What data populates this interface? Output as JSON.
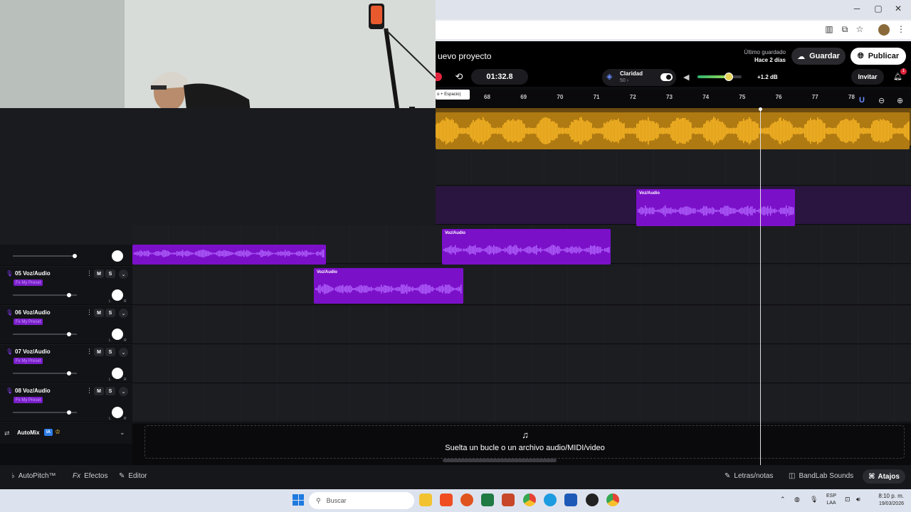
{
  "window": {
    "minimize": "─",
    "maximize": "▢",
    "close": "✕"
  },
  "browser_toolbar": {
    "icons": [
      "reading-list-icon",
      "screen-cast-icon",
      "bookmark-star-icon",
      "profile-avatar",
      "menu-dots-icon"
    ]
  },
  "header": {
    "project_title": "uevo proyecto",
    "saved_label": "Último guardado",
    "saved_value": "Hace 2 días",
    "save_label": "Guardar",
    "publish_label": "Publicar"
  },
  "transport": {
    "time": "01:32.8",
    "clarity_label": "Claridad",
    "clarity_value": "50 ›",
    "clarity_on": true,
    "volume_level": 0.72,
    "volume_db": "+1.2 dB",
    "invite_label": "Invitar",
    "notifications": "1",
    "tooltip": "o + Espacio)"
  },
  "ruler": {
    "bars": [
      "68",
      "69",
      "70",
      "71",
      "72",
      "73",
      "74",
      "75",
      "76",
      "77",
      "78"
    ]
  },
  "tracks": [
    {
      "num": "05",
      "name": "Voz/Audio",
      "m": "M",
      "s": "S",
      "fx": "Fx My Preset",
      "volume": 0.9
    },
    {
      "num": "06",
      "name": "Voz/Audio",
      "m": "M",
      "s": "S",
      "fx": "Fx My Preset",
      "volume": 0.9
    },
    {
      "num": "07",
      "name": "Voz/Audio",
      "m": "M",
      "s": "S",
      "fx": "Fx My Preset",
      "volume": 0.9
    },
    {
      "num": "08",
      "name": "Voz/Audio",
      "m": "M",
      "s": "S",
      "fx": "Fx My Preset",
      "volume": 0.9
    }
  ],
  "clips": {
    "label": "Voz/Audio"
  },
  "automix": {
    "label": "AutoMix",
    "badge": "IA"
  },
  "drop": {
    "text": "Suelta un bucle o un archivo audio/MIDI/video"
  },
  "bottom": {
    "autopitch": "AutoPitch™",
    "effects": "Efectos",
    "editor": "Editor",
    "lyrics": "Letras/notas",
    "sounds": "BandLab Sounds",
    "shortcuts": "Atajos"
  },
  "taskbar": {
    "search": "Buscar",
    "lang1": "ESP",
    "lang2": "LAA",
    "time": "8:10 p. m.",
    "date": "19/03/2026"
  },
  "colors": {
    "accent_purple": "#7b10c9",
    "waveform_orange": "#f5b324",
    "record_red": "#e2233d"
  }
}
